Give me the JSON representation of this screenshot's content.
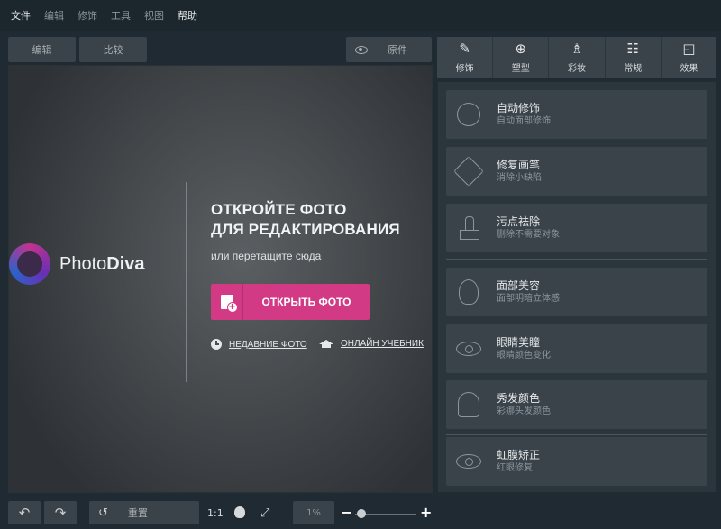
{
  "menu": [
    "文件",
    "编辑",
    "修饰",
    "工具",
    "视图",
    "帮助"
  ],
  "toolbar": {
    "edit": "编辑",
    "compare": "比较",
    "original": "原件"
  },
  "logo": {
    "part1": "Photo",
    "part2": "Diva"
  },
  "welcome": {
    "line1": "ОТКРОЙТЕ ФОТО",
    "line2": "ДЛЯ РЕДАКТИРОВАНИЯ",
    "sub": "или перетащите сюда",
    "open_btn": "ОТКРЫТЬ ФОТО",
    "recent": "НЕДАВНИЕ ФОТО",
    "tutorial": "ОНЛАЙН УЧЕБНИК"
  },
  "bottom": {
    "reset": "重置",
    "ratio": "1:1",
    "zoom": "1%"
  },
  "tabs": [
    {
      "label": "修饰",
      "icon": "✎"
    },
    {
      "label": "塑型",
      "icon": "⊕"
    },
    {
      "label": "彩妆",
      "icon": "♗"
    },
    {
      "label": "常规",
      "icon": "☷"
    },
    {
      "label": "效果",
      "icon": "◰"
    }
  ],
  "features": [
    {
      "title": "自动修饰",
      "sub": "自动面部修饰"
    },
    {
      "title": "修复画笔",
      "sub": "消除小缺陷"
    },
    {
      "title": "污点祛除",
      "sub": "删除不需要对象"
    },
    {
      "title": "面部美容",
      "sub": "面部明暗立体感"
    },
    {
      "title": "眼睛美瞳",
      "sub": "眼睛颜色变化"
    },
    {
      "title": "秀发颜色",
      "sub": "彩娜头发颜色"
    },
    {
      "title": "虹膜矫正",
      "sub": "红眼修复"
    }
  ],
  "colors": {
    "accent": "#d23a86",
    "panel": "#394349",
    "bg": "#1f2a32"
  }
}
